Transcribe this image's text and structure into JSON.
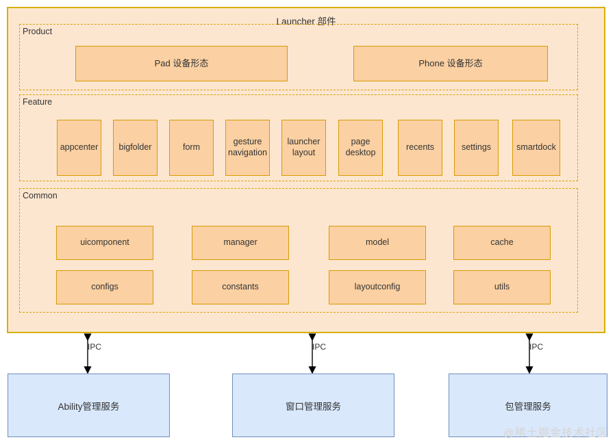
{
  "diagram": {
    "title": "Launcher 部件",
    "watermark": "@稀土掘金技术社区",
    "colors": {
      "container_fill": "#fde6d0",
      "container_border": "#d6b000",
      "group_border": "#d6a100",
      "cell_fill": "#fbd0a2",
      "cell_border": "#d79b00",
      "service_fill": "#dae8fc",
      "service_border": "#6c8ebf",
      "text": "#333333",
      "watermark": "#d5d5d5"
    }
  },
  "groups": {
    "product": {
      "label": "Product",
      "items": [
        {
          "label": "Pad 设备形态"
        },
        {
          "label": "Phone 设备形态"
        }
      ]
    },
    "feature": {
      "label": "Feature",
      "items": [
        {
          "label": "appcenter"
        },
        {
          "label": "bigfolder"
        },
        {
          "label": "form"
        },
        {
          "label": "gesture navigation"
        },
        {
          "label": "launcher layout"
        },
        {
          "label": "page desktop"
        },
        {
          "label": "recents"
        },
        {
          "label": "settings"
        },
        {
          "label": "smartdock"
        }
      ]
    },
    "common": {
      "label": "Common",
      "items": [
        {
          "label": "uicomponent"
        },
        {
          "label": "manager"
        },
        {
          "label": "model"
        },
        {
          "label": "cache"
        },
        {
          "label": "configs"
        },
        {
          "label": "constants"
        },
        {
          "label": "layoutconfig"
        },
        {
          "label": "utils"
        }
      ]
    }
  },
  "connectors": [
    {
      "label": "IPC"
    },
    {
      "label": "IPC"
    },
    {
      "label": "IPC"
    }
  ],
  "services": [
    {
      "label": "Ability管理服务"
    },
    {
      "label": "窗口管理服务"
    },
    {
      "label": "包管理服务"
    }
  ]
}
